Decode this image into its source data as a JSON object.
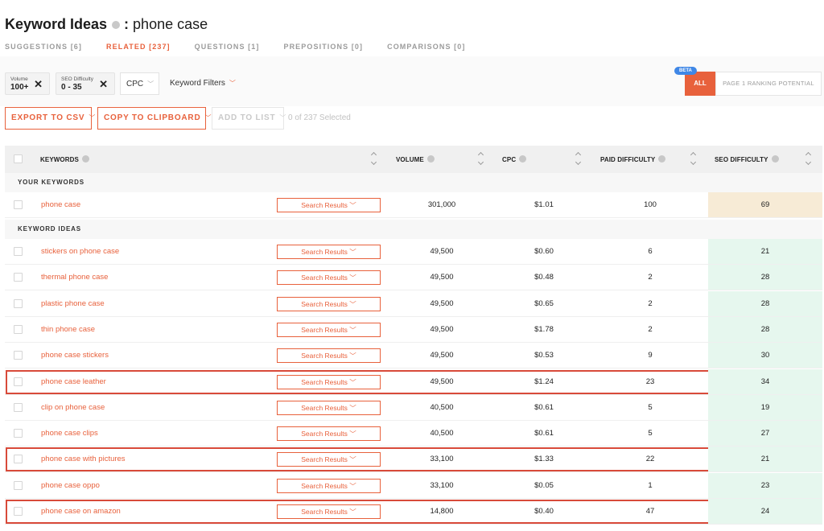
{
  "header": {
    "title": "Keyword Ideas",
    "separator": ":",
    "query": "phone case"
  },
  "tabs": [
    {
      "label": "SUGGESTIONS [6]",
      "active": false
    },
    {
      "label": "RELATED [237]",
      "active": true
    },
    {
      "label": "QUESTIONS [1]",
      "active": false
    },
    {
      "label": "PREPOSITIONS [0]",
      "active": false
    },
    {
      "label": "COMPARISONS [0]",
      "active": false
    }
  ],
  "filters": {
    "volume": {
      "label": "Volume",
      "value": "100+",
      "remove": "✕"
    },
    "seo_difficulty": {
      "label": "SEO Difficulty",
      "value": "0 - 35",
      "remove": "✕"
    },
    "cpc": {
      "label": "CPC"
    },
    "keyword_filters": {
      "label": "Keyword Filters"
    }
  },
  "ranking": {
    "beta": "BETA",
    "all": "ALL",
    "page1": "PAGE 1 RANKING POTENTIAL"
  },
  "actions": {
    "export": "EXPORT TO CSV",
    "copy": "COPY TO CLIPBOARD",
    "add": "ADD TO LIST",
    "selected": "0 of 237 Selected"
  },
  "table": {
    "columns": [
      "KEYWORDS",
      "VOLUME",
      "CPC",
      "PAID DIFFICULTY",
      "SEO DIFFICULTY"
    ],
    "sections": {
      "yours": "YOUR KEYWORDS",
      "ideas": "KEYWORD IDEAS"
    },
    "search_results_label": "Search Results",
    "your_keywords": [
      {
        "keyword": "phone case",
        "volume": "301,000",
        "cpc": "$1.01",
        "paid_difficulty": "100",
        "seo_difficulty": "69"
      }
    ],
    "keyword_ideas": [
      {
        "keyword": "stickers on phone case",
        "volume": "49,500",
        "cpc": "$0.60",
        "paid_difficulty": "6",
        "seo_difficulty": "21"
      },
      {
        "keyword": "thermal phone case",
        "volume": "49,500",
        "cpc": "$0.48",
        "paid_difficulty": "2",
        "seo_difficulty": "28"
      },
      {
        "keyword": "plastic phone case",
        "volume": "49,500",
        "cpc": "$0.65",
        "paid_difficulty": "2",
        "seo_difficulty": "28"
      },
      {
        "keyword": "thin phone case",
        "volume": "49,500",
        "cpc": "$1.78",
        "paid_difficulty": "2",
        "seo_difficulty": "28"
      },
      {
        "keyword": "phone case stickers",
        "volume": "49,500",
        "cpc": "$0.53",
        "paid_difficulty": "9",
        "seo_difficulty": "30"
      },
      {
        "keyword": "phone case leather",
        "volume": "49,500",
        "cpc": "$1.24",
        "paid_difficulty": "23",
        "seo_difficulty": "34"
      },
      {
        "keyword": "clip on phone case",
        "volume": "40,500",
        "cpc": "$0.61",
        "paid_difficulty": "5",
        "seo_difficulty": "19"
      },
      {
        "keyword": "phone case clips",
        "volume": "40,500",
        "cpc": "$0.61",
        "paid_difficulty": "5",
        "seo_difficulty": "27"
      },
      {
        "keyword": "phone case with pictures",
        "volume": "33,100",
        "cpc": "$1.33",
        "paid_difficulty": "22",
        "seo_difficulty": "21"
      },
      {
        "keyword": "phone case oppo",
        "volume": "33,100",
        "cpc": "$0.05",
        "paid_difficulty": "1",
        "seo_difficulty": "23"
      },
      {
        "keyword": "phone case on amazon",
        "volume": "14,800",
        "cpc": "$0.40",
        "paid_difficulty": "47",
        "seo_difficulty": "24"
      }
    ]
  },
  "colors": {
    "accent": "#e8613c",
    "seo_low": "#e6f7ee",
    "seo_medium": "#f7ebd6",
    "highlight": "#d84a3a"
  }
}
